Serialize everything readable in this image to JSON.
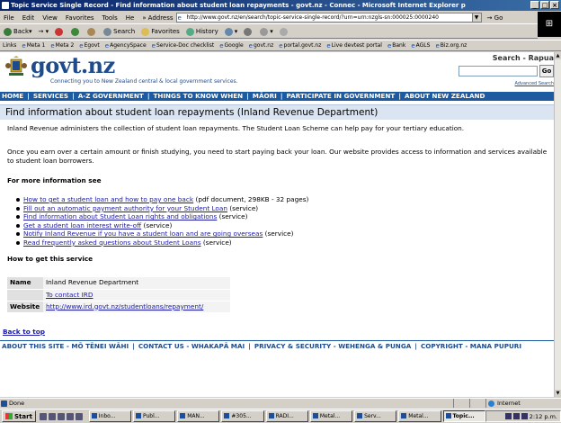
{
  "window": {
    "title": "Topic Service Single Record - Find information about student loan repayments - govt.nz - Connec - Microsoft Internet Explorer p"
  },
  "menubar": {
    "items": [
      "File",
      "Edit",
      "View",
      "Favorites",
      "Tools",
      "He"
    ],
    "overflow": "»",
    "address_label": "Address",
    "url": "http://www.govt.nz/en/search/topic-service-single-record/?urn=urn:nzgls-sn:000025:0000240",
    "go_label": "Go"
  },
  "toolbar": {
    "back": "Back",
    "search": "Search",
    "favorites": "Favorites",
    "history": "History"
  },
  "linksbar": {
    "label": "Links",
    "items": [
      "Meta 1",
      "Meta 2",
      "Egovt",
      "AgencySpace",
      "Service-Doc checklist",
      "Google",
      "govt.nz",
      "portal.govt.nz",
      "Live devtest portal",
      "Bank",
      "AGLS",
      "Biz.org.nz"
    ]
  },
  "header": {
    "brand": "govt.nz",
    "tagline": "Connecting you to New Zealand central & local government services.",
    "search_label": "Search - Rapua",
    "go": "Go",
    "advanced": "Advanced Search"
  },
  "nav": {
    "items": [
      "HOME",
      "SERVICES",
      "A-Z GOVERNMENT",
      "THINGS TO KNOW WHEN",
      "MĀORI",
      "PARTICIPATE IN GOVERNMENT",
      "ABOUT NEW ZEALAND"
    ]
  },
  "page": {
    "title": "Find information about student loan repayments (Inland Revenue Department)",
    "intro": "Inland Revenue administers the collection of student loan repayments. The Student Loan Scheme can help pay for your tertiary education.",
    "para2": "Once you earn over a certain amount or finish studying, you need to start paying back your loan. Our website provides access to information and services available to student loan borrowers.",
    "more_heading": "For more information see",
    "links": [
      {
        "text": "How to get a student loan and how to pay one back",
        "suffix": " (pdf document, 298KB - 32 pages)"
      },
      {
        "text": "Fill out an automatic payment authority for your Student Loan",
        "suffix": " (service)"
      },
      {
        "text": "Find information about Student Loan rights and obligations",
        "suffix": " (service)"
      },
      {
        "text": "Get a student loan interest write-off",
        "suffix": " (service)"
      },
      {
        "text": "Notify Inland Revenue if you have a student loan and are going overseas",
        "suffix": " (service)"
      },
      {
        "text": "Read frequently asked questions about Student Loans",
        "suffix": " (service)"
      }
    ],
    "how_heading": "How to get this service",
    "info": {
      "name_label": "Name",
      "name_value": "Inland Revenue Department",
      "contact_link": "To contact IRD",
      "website_label": "Website",
      "website_value": "http://www.ird.govt.nz/studentloans/repayment/"
    },
    "back_to_top": "Back to top"
  },
  "footer": {
    "items": [
      "ABOUT THIS SITE - MŌ TĒNEI WĀHI",
      "CONTACT US - WHAKAPĀ MAI",
      "PRIVACY & SECURITY - WEHENGA & PUNGA",
      "COPYRIGHT - MANA PUPURI"
    ]
  },
  "status": {
    "text": "Done",
    "zone": "Internet"
  },
  "taskbar": {
    "start": "Start",
    "tasks": [
      "Inbo...",
      "Publ...",
      "MAN...",
      "#305...",
      "RADI...",
      "Metal...",
      "Serv...",
      "Metal...",
      "Topic..."
    ],
    "clock": "2:12 p.m."
  }
}
